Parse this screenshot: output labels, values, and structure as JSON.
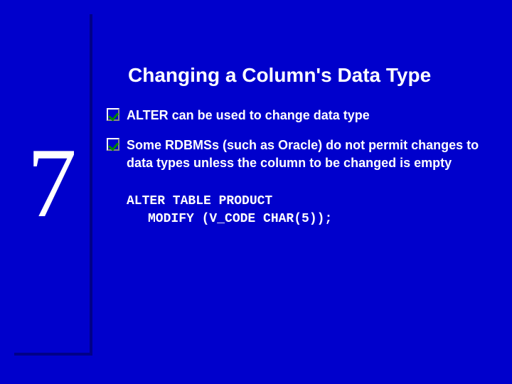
{
  "chapter": {
    "number": "7"
  },
  "slide": {
    "title": "Changing a Column's Data Type",
    "bullets": [
      {
        "text": "ALTER can be used to change data type"
      },
      {
        "text": "Some RDBMSs (such as Oracle) do not permit changes to data types unless the column to be changed is empty"
      }
    ],
    "code": {
      "line1": "ALTER TABLE PRODUCT",
      "line2": "MODIFY (V_CODE CHAR(5));"
    }
  }
}
